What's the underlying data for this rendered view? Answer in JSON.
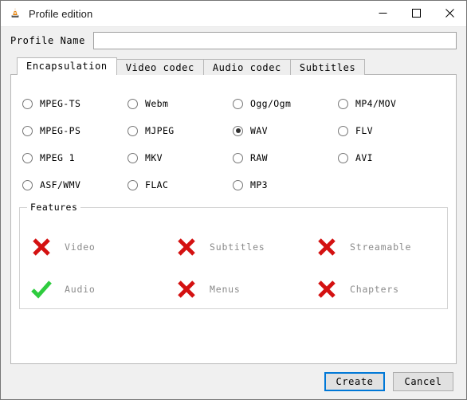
{
  "window": {
    "title": "Profile edition",
    "icon": "vlc-cone-icon",
    "controls": [
      {
        "name": "minimize-button",
        "glyph": "minimize-icon"
      },
      {
        "name": "maximize-button",
        "glyph": "maximize-icon"
      },
      {
        "name": "close-button",
        "glyph": "close-icon"
      }
    ]
  },
  "profile": {
    "label": "Profile Name",
    "value": "",
    "placeholder": ""
  },
  "tabs": [
    {
      "label": "Encapsulation",
      "active": true
    },
    {
      "label": "Video codec",
      "active": false
    },
    {
      "label": "Audio codec",
      "active": false
    },
    {
      "label": "Subtitles",
      "active": false
    }
  ],
  "encapsulation": {
    "selected": "WAV",
    "options": [
      {
        "label": "MPEG-TS",
        "checked": false
      },
      {
        "label": "Webm",
        "checked": false
      },
      {
        "label": "Ogg/Ogm",
        "checked": false
      },
      {
        "label": "MP4/MOV",
        "checked": false
      },
      {
        "label": "MPEG-PS",
        "checked": false
      },
      {
        "label": "MJPEG",
        "checked": false
      },
      {
        "label": "WAV",
        "checked": true
      },
      {
        "label": "FLV",
        "checked": false
      },
      {
        "label": "MPEG 1",
        "checked": false
      },
      {
        "label": "MKV",
        "checked": false
      },
      {
        "label": "RAW",
        "checked": false
      },
      {
        "label": "AVI",
        "checked": false
      },
      {
        "label": "ASF/WMV",
        "checked": false
      },
      {
        "label": "FLAC",
        "checked": false
      },
      {
        "label": "MP3",
        "checked": false
      },
      {
        "label": "",
        "checked": false,
        "empty": true
      }
    ]
  },
  "features": {
    "legend": "Features",
    "items": [
      {
        "label": "Video",
        "state": "cross"
      },
      {
        "label": "Subtitles",
        "state": "cross"
      },
      {
        "label": "Streamable",
        "state": "cross"
      },
      {
        "label": "Audio",
        "state": "check"
      },
      {
        "label": "Menus",
        "state": "cross"
      },
      {
        "label": "Chapters",
        "state": "cross"
      }
    ]
  },
  "footer": {
    "create_label": "Create",
    "cancel_label": "Cancel"
  },
  "colors": {
    "accent": "#0078d7",
    "cross": "#d41111",
    "check": "#2ecc3e",
    "dialog_bg": "#f0f0f0"
  }
}
